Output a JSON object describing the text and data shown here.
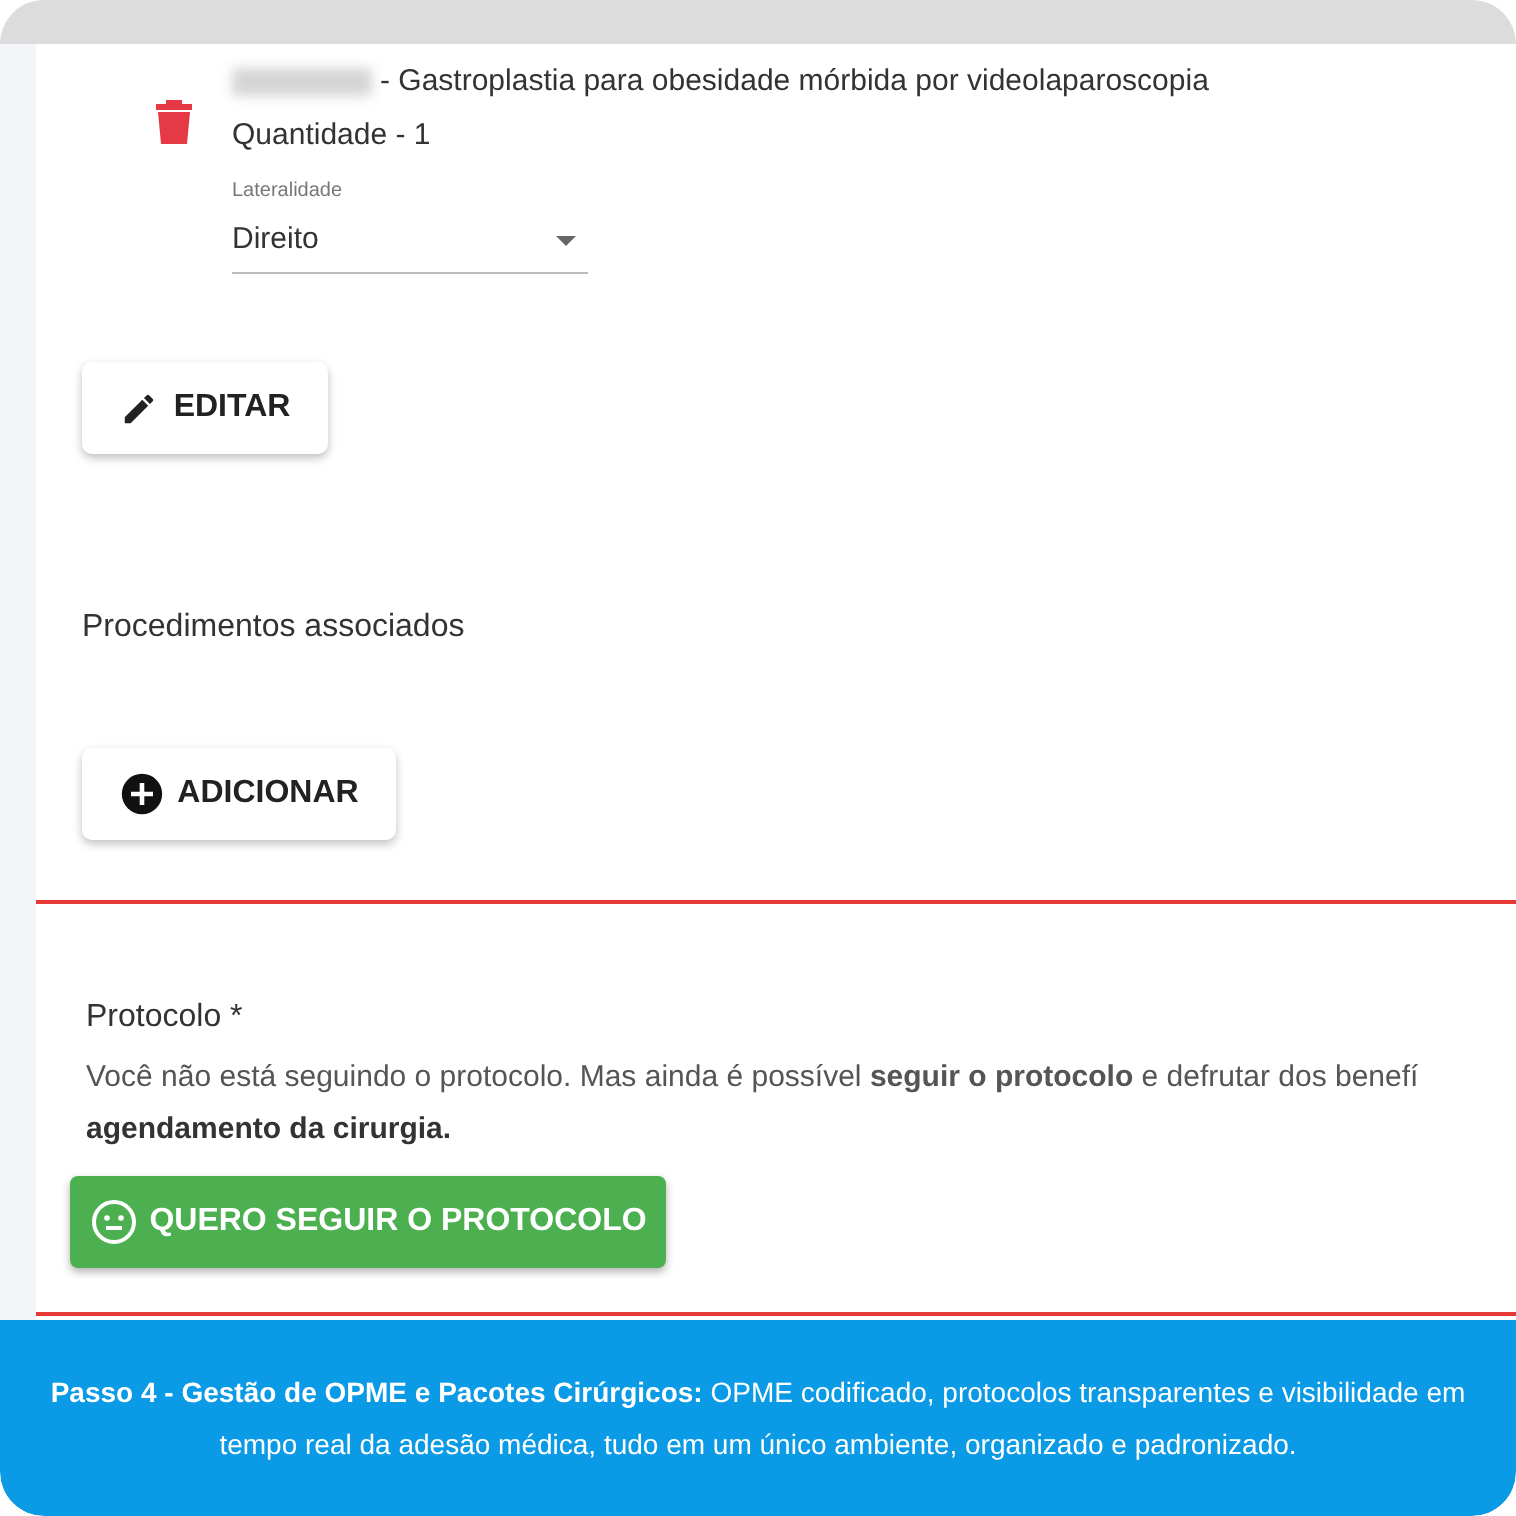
{
  "procedure": {
    "name": "- Gastroplastia para obesidade mórbida por videolaparoscopia",
    "quantity": "Quantidade - 1",
    "laterality": {
      "label": "Lateralidade",
      "value": "Direito"
    }
  },
  "edit_button": "EDITAR",
  "associated": {
    "title": "Procedimentos associados",
    "add_button": "ADICIONAR"
  },
  "protocol": {
    "title": "Protocolo *",
    "error": true,
    "lines": [
      {
        "text": "Você não está seguindo o protocolo. Mas ainda é possível **seguir o protocolo** e defrutar dos benefí",
        "bold": false
      },
      {
        "text": "agendamento da cirurgia.",
        "bold": true
      }
    ],
    "button": "QUERO SEGUIR O PROTOCOLO"
  },
  "caption": "**Passo 4 - Gestão de OPME e Pacotes Cirúrgicos:** OPME codificado, protocolos transparentes e visibilidade em tempo real da adesão médica, tudo em um único ambiente, organizado e padronizado."
}
